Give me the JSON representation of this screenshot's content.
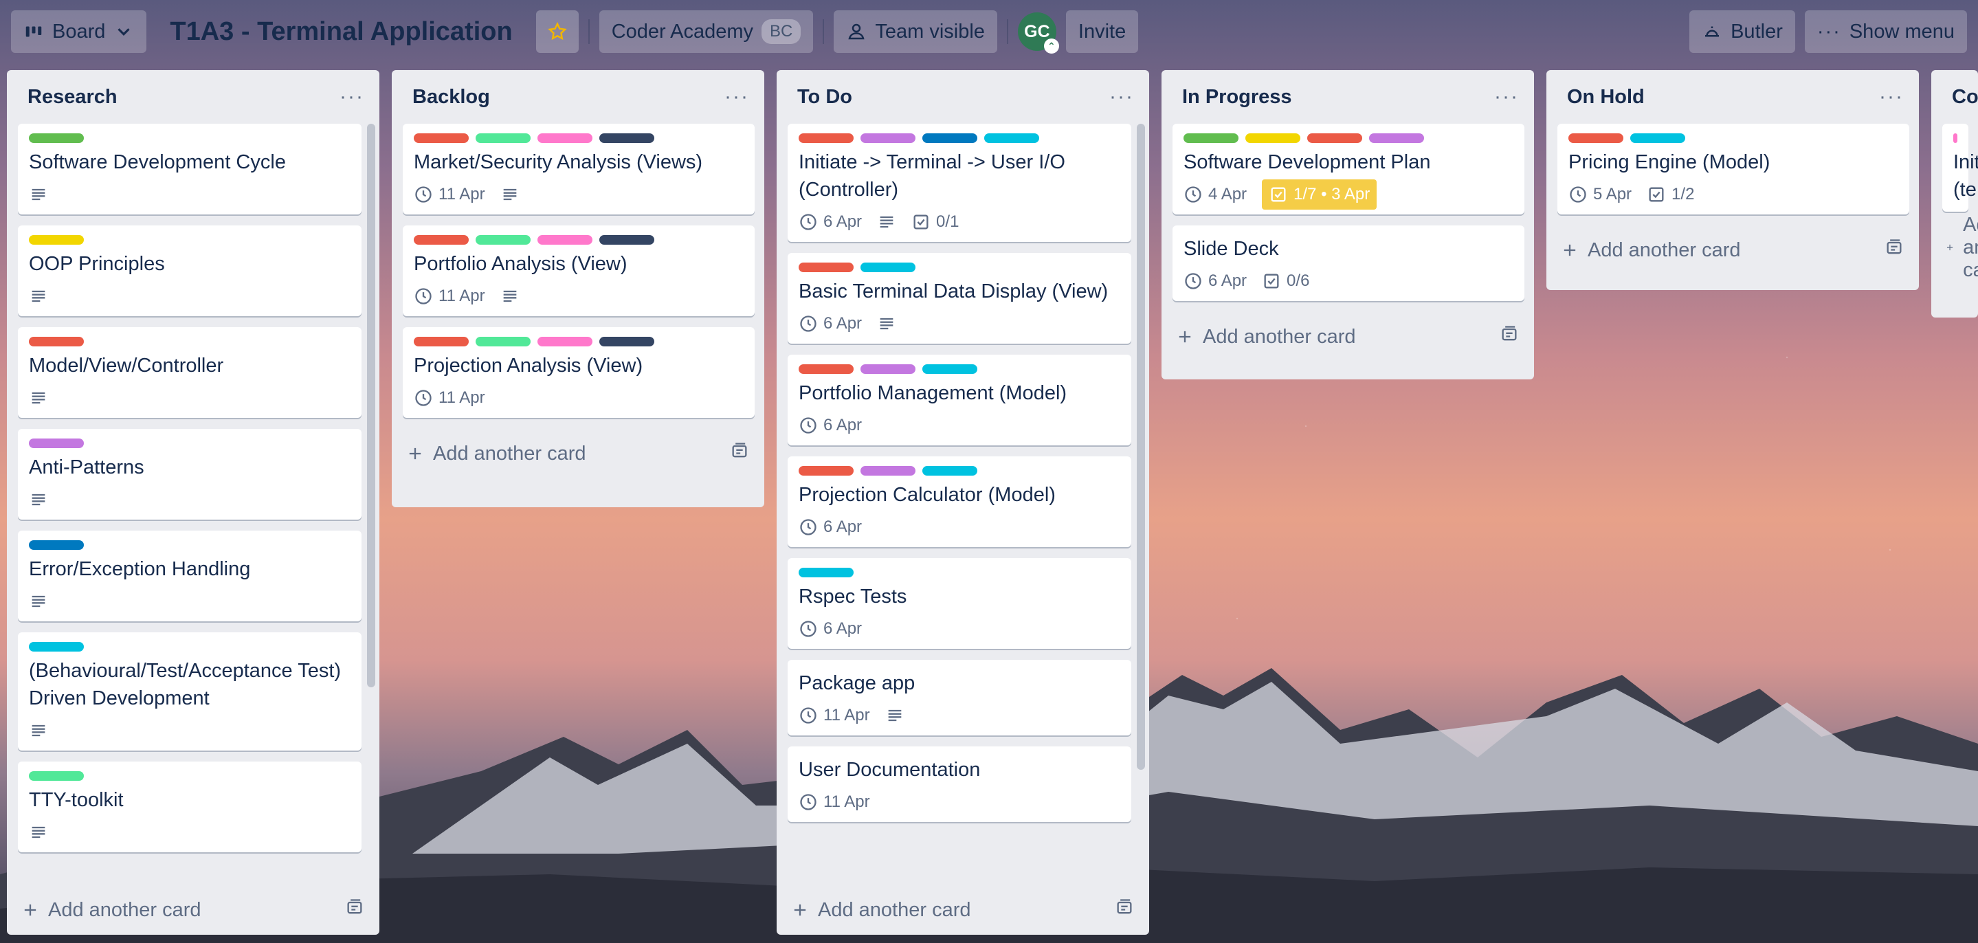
{
  "header": {
    "board_switcher": "Board",
    "title": "T1A3 - Terminal Application",
    "workspace": "Coder Academy",
    "workspace_badge": "BC",
    "visibility": "Team visible",
    "avatar_initials": "GC",
    "invite": "Invite",
    "butler": "Butler",
    "show_menu": "Show menu"
  },
  "add_card_label": "Add another card",
  "lists": [
    {
      "title": "Research",
      "cards": [
        {
          "labels": [
            "#61bd4f"
          ],
          "title": "Software Development Cycle",
          "description": true
        },
        {
          "labels": [
            "#f2d600"
          ],
          "title": "OOP Principles",
          "description": true
        },
        {
          "labels": [
            "#eb5a46"
          ],
          "title": "Model/View/Controller",
          "description": true
        },
        {
          "labels": [
            "#c377e0"
          ],
          "title": "Anti-Patterns",
          "description": true
        },
        {
          "labels": [
            "#0079bf"
          ],
          "title": "Error/Exception Handling",
          "description": true
        },
        {
          "labels": [
            "#00c2e0"
          ],
          "title": "(Behavioural/Test/Acceptance Test) Driven Development",
          "description": true
        },
        {
          "labels": [
            "#51e898"
          ],
          "title": "TTY-toolkit",
          "description": true
        }
      ]
    },
    {
      "title": "Backlog",
      "cards": [
        {
          "labels": [
            "#eb5a46",
            "#51e898",
            "#ff78cb",
            "#344563"
          ],
          "title": "Market/Security Analysis (Views)",
          "due": "11 Apr",
          "description": true
        },
        {
          "labels": [
            "#eb5a46",
            "#51e898",
            "#ff78cb",
            "#344563"
          ],
          "title": "Portfolio Analysis (View)",
          "due": "11 Apr",
          "description": true
        },
        {
          "labels": [
            "#eb5a46",
            "#51e898",
            "#ff78cb",
            "#344563"
          ],
          "title": "Projection Analysis (View)",
          "due": "11 Apr"
        }
      ]
    },
    {
      "title": "To Do",
      "cards": [
        {
          "labels": [
            "#eb5a46",
            "#c377e0",
            "#0079bf",
            "#00c2e0"
          ],
          "title": "Initiate -> Terminal -> User I/O (Controller)",
          "due": "6 Apr",
          "description": true,
          "checklist": "0/1"
        },
        {
          "labels": [
            "#eb5a46",
            "#00c2e0"
          ],
          "title": "Basic Terminal Data Display (View)",
          "due": "6 Apr",
          "description": true
        },
        {
          "labels": [
            "#eb5a46",
            "#c377e0",
            "#00c2e0"
          ],
          "title": "Portfolio Management (Model)",
          "due": "6 Apr"
        },
        {
          "labels": [
            "#eb5a46",
            "#c377e0",
            "#00c2e0"
          ],
          "title": "Projection Calculator (Model)",
          "due": "6 Apr"
        },
        {
          "labels": [
            "#00c2e0"
          ],
          "title": "Rspec Tests",
          "due": "6 Apr"
        },
        {
          "labels": [],
          "title": "Package app",
          "due": "11 Apr",
          "description": true
        },
        {
          "labels": [],
          "title": "User Documentation",
          "due": "11 Apr"
        }
      ]
    },
    {
      "title": "In Progress",
      "cards": [
        {
          "labels": [
            "#61bd4f",
            "#f2d600",
            "#eb5a46",
            "#c377e0"
          ],
          "title": "Software Development Plan",
          "due": "4 Apr",
          "checklist_due": "1/7 • 3 Apr"
        },
        {
          "labels": [],
          "title": "Slide Deck",
          "due": "6 Apr",
          "checklist": "0/6"
        }
      ]
    },
    {
      "title": "On Hold",
      "cards": [
        {
          "labels": [
            "#eb5a46",
            "#00c2e0"
          ],
          "title": "Pricing Engine (Model)",
          "due": "5 Apr",
          "checklist": "1/2"
        }
      ]
    },
    {
      "title": "Co",
      "cards": [
        {
          "labels": [
            "#ff78cb"
          ],
          "title": "Init (te"
        }
      ]
    }
  ]
}
